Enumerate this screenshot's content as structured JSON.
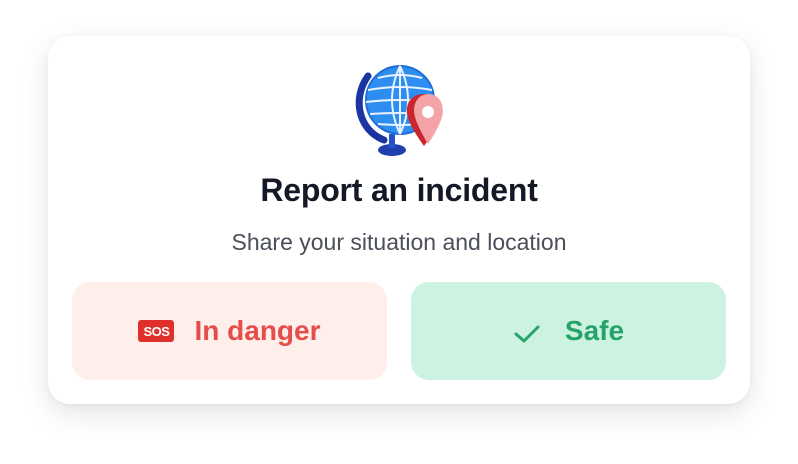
{
  "dialog": {
    "illustration": "globe-with-location-pin-icon",
    "title": "Report an incident",
    "subtitle": "Share your situation and location"
  },
  "actions": {
    "danger": {
      "label": "In danger",
      "icon": "sos-icon",
      "icon_text": "SOS",
      "color": "#e44d4a",
      "background": "#ffefeb"
    },
    "safe": {
      "label": "Safe",
      "icon": "check-icon",
      "color": "#26a368",
      "background": "#ccf2e1"
    }
  }
}
